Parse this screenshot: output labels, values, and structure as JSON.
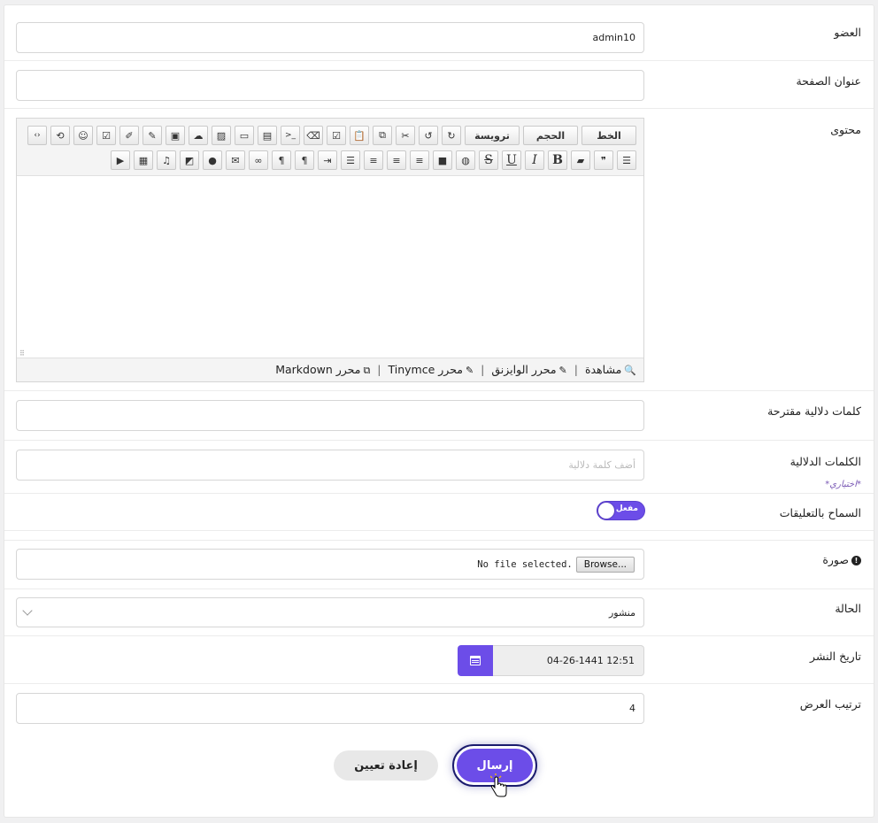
{
  "form": {
    "member": {
      "label": "العضو",
      "value": "admin10"
    },
    "page_title": {
      "label": "عنوان الصفحة",
      "value": ""
    },
    "content": {
      "label": "محتوى",
      "toolbar": {
        "font_label": "الخط",
        "size_label": "الحجم",
        "heading_label": "ترويسة"
      },
      "footer": {
        "preview": "مشاهدة",
        "wysiwyg": "محرر الوايزنق",
        "tinymce": "محرر Tinymce",
        "markdown": "محرر Markdown",
        "separator": "|"
      }
    },
    "suggested_tags": {
      "label": "كلمات دلالية مقترحة",
      "value": ""
    },
    "tags": {
      "label": "الكلمات الدلالية",
      "placeholder": "أضف كلمة دلالية",
      "hint": "*اختياري*"
    },
    "comments": {
      "label": "السماح بالتعليقات",
      "toggle_text": "مفعل",
      "enabled": true
    },
    "image": {
      "label": "صورة",
      "browse_label": "Browse...",
      "status": "No file selected."
    },
    "status": {
      "label": "الحالة",
      "value": "منشور"
    },
    "publish_date": {
      "label": "تاريخ النشر",
      "value": "12:51  04-26-1441"
    },
    "display_order": {
      "label": "ترتيب العرض",
      "value": "4"
    }
  },
  "actions": {
    "submit_label": "إرسال",
    "reset_label": "إعادة تعيين"
  },
  "colors": {
    "accent": "#6c4de8",
    "focus_ring": "#1b1b6e"
  }
}
